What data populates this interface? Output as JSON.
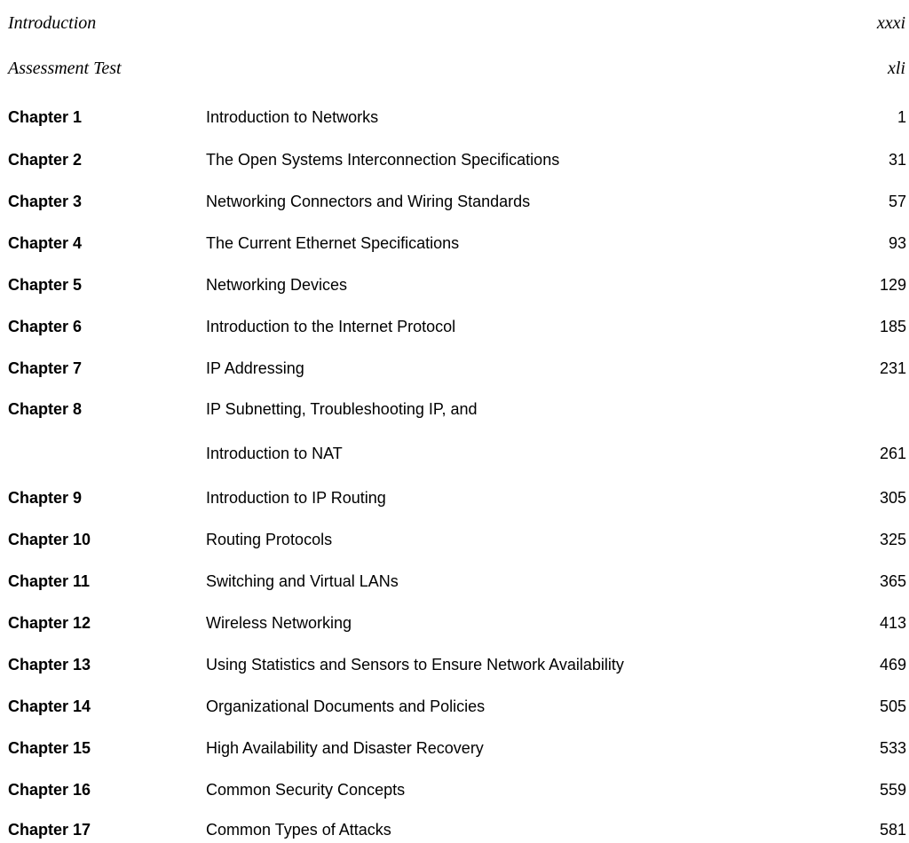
{
  "front_matter": [
    {
      "label": "Introduction",
      "page": "xxxi"
    },
    {
      "label": "Assessment Test",
      "page": "xli"
    }
  ],
  "chapters": [
    {
      "label": "Chapter 1",
      "title": "Introduction to Networks",
      "page": "1"
    },
    {
      "label": "Chapter 2",
      "title": "The Open Systems Interconnection Specifications",
      "page": "31"
    },
    {
      "label": "Chapter 3",
      "title": "Networking Connectors and Wiring Standards",
      "page": "57"
    },
    {
      "label": "Chapter 4",
      "title": "The Current Ethernet Specifications",
      "page": "93"
    },
    {
      "label": "Chapter 5",
      "title": "Networking Devices",
      "page": "129"
    },
    {
      "label": "Chapter 6",
      "title": "Introduction to the Internet Protocol",
      "page": "185"
    },
    {
      "label": "Chapter 7",
      "title": "IP Addressing",
      "page": "231"
    },
    {
      "label": "Chapter 8",
      "title": "IP Subnetting, Troubleshooting IP, and",
      "title_cont": "Introduction to NAT",
      "page": "261"
    },
    {
      "label": "Chapter 9",
      "title": "Introduction to IP Routing",
      "page": "305"
    },
    {
      "label": "Chapter 10",
      "title": "Routing Protocols",
      "page": "325"
    },
    {
      "label": "Chapter 11",
      "title": "Switching and Virtual LANs",
      "page": "365"
    },
    {
      "label": "Chapter 12",
      "title": "Wireless Networking",
      "page": "413"
    },
    {
      "label": "Chapter 13",
      "title": "Using Statistics and Sensors to Ensure Network Availability",
      "page": "469"
    },
    {
      "label": "Chapter 14",
      "title": "Organizational Documents and Policies",
      "page": "505"
    },
    {
      "label": "Chapter 15",
      "title": "High Availability and Disaster Recovery",
      "page": "533"
    },
    {
      "label": "Chapter 16",
      "title": "Common Security Concepts",
      "page": "559"
    },
    {
      "label": "Chapter 17",
      "title": "Common Types of Attacks",
      "page": "581"
    }
  ]
}
